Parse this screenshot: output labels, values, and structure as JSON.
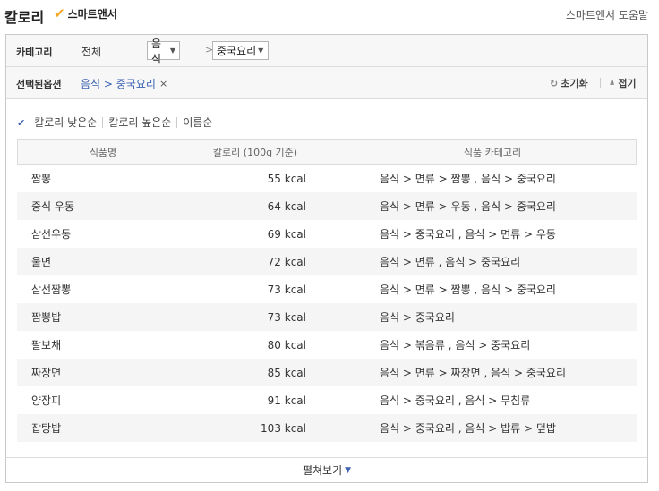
{
  "header": {
    "title": "칼로리",
    "brand": "스마트앤서",
    "help": "스마트앤서 도움말"
  },
  "category": {
    "label": "카테고리",
    "all": "전체",
    "level1": "음식",
    "separator": ">",
    "level2": "중국요리"
  },
  "selected": {
    "label": "선택된옵션",
    "path": "음식 > 중국요리",
    "remove": "×",
    "reset": "초기화",
    "collapse": "접기"
  },
  "sort": {
    "options": [
      "칼로리 낮은순",
      "칼로리 높은순",
      "이름순"
    ]
  },
  "table": {
    "headers": [
      "식품명",
      "칼로리 (100g 기준)",
      "식품 카테고리"
    ],
    "rows": [
      {
        "name": "짬뽕",
        "kcal": "55 kcal",
        "category": "음식 > 면류 > 짬뽕 , 음식 > 중국요리"
      },
      {
        "name": "중식 우동",
        "kcal": "64 kcal",
        "category": "음식 > 면류 > 우동 , 음식 > 중국요리"
      },
      {
        "name": "삼선우동",
        "kcal": "69 kcal",
        "category": "음식 > 중국요리 , 음식 > 면류 > 우동"
      },
      {
        "name": "울면",
        "kcal": "72 kcal",
        "category": "음식 > 면류 , 음식 > 중국요리"
      },
      {
        "name": "삼선짬뽕",
        "kcal": "73 kcal",
        "category": "음식 > 면류 > 짬뽕 , 음식 > 중국요리"
      },
      {
        "name": "짬뽕밥",
        "kcal": "73 kcal",
        "category": "음식 > 중국요리"
      },
      {
        "name": "팔보채",
        "kcal": "80 kcal",
        "category": "음식 > 볶음류 , 음식 > 중국요리"
      },
      {
        "name": "짜장면",
        "kcal": "85 kcal",
        "category": "음식 > 면류 > 짜장면 , 음식 > 중국요리"
      },
      {
        "name": "양장피",
        "kcal": "91 kcal",
        "category": "음식 > 중국요리 , 음식 > 무침류"
      },
      {
        "name": "잡탕밥",
        "kcal": "103 kcal",
        "category": "음식 > 중국요리 , 음식 > 밥류 > 덮밥"
      }
    ]
  },
  "footer": {
    "expand": "펼쳐보기"
  }
}
